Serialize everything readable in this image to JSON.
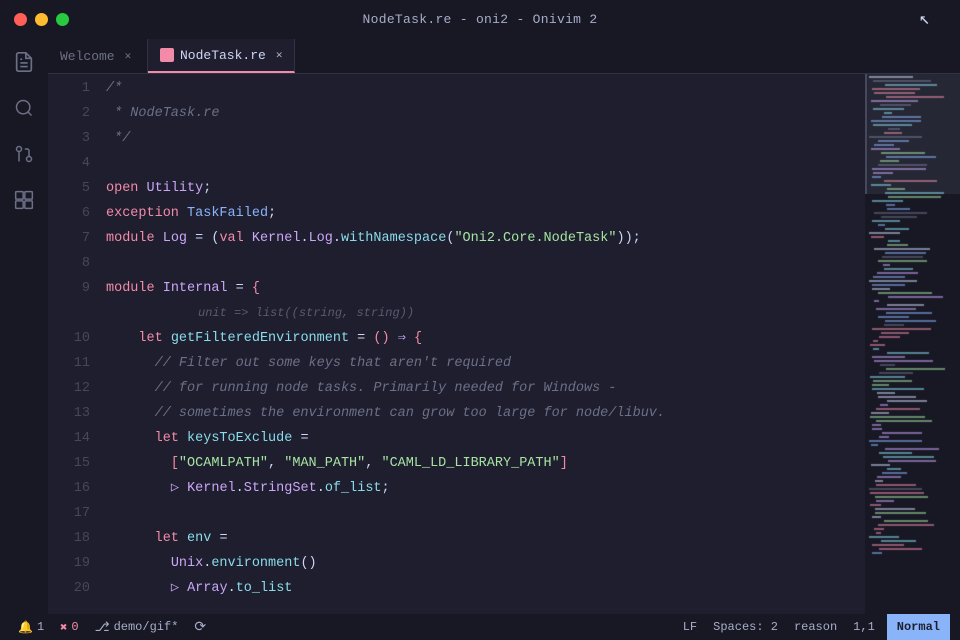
{
  "titlebar": {
    "title": "NodeTask.re - oni2 - Onivim 2"
  },
  "tabs": [
    {
      "id": "welcome",
      "label": "Welcome",
      "active": false,
      "has_icon": false
    },
    {
      "id": "nodetask",
      "label": "NodeTask.re",
      "active": true,
      "has_icon": true
    }
  ],
  "code": {
    "lines": [
      {
        "num": 1,
        "tokens": [
          {
            "t": "kw-comment",
            "v": "/*"
          }
        ]
      },
      {
        "num": 2,
        "tokens": [
          {
            "t": "kw-comment",
            "v": " * NodeTask.re"
          }
        ]
      },
      {
        "num": 3,
        "tokens": [
          {
            "t": "kw-comment",
            "v": " */"
          }
        ]
      },
      {
        "num": 4,
        "tokens": []
      },
      {
        "num": 5,
        "tokens": [
          {
            "t": "kw-keyword",
            "v": "open"
          },
          {
            "t": "kw-normal",
            "v": " "
          },
          {
            "t": "kw-module",
            "v": "Utility"
          },
          {
            "t": "kw-normal",
            "v": ";"
          }
        ]
      },
      {
        "num": 6,
        "tokens": [
          {
            "t": "kw-keyword",
            "v": "exception"
          },
          {
            "t": "kw-normal",
            "v": " "
          },
          {
            "t": "kw-type",
            "v": "TaskFailed"
          },
          {
            "t": "kw-normal",
            "v": ";"
          }
        ]
      },
      {
        "num": 7,
        "tokens": [
          {
            "t": "kw-keyword",
            "v": "module"
          },
          {
            "t": "kw-normal",
            "v": " "
          },
          {
            "t": "kw-module",
            "v": "Log"
          },
          {
            "t": "kw-normal",
            "v": " = ("
          },
          {
            "t": "kw-keyword",
            "v": "val"
          },
          {
            "t": "kw-normal",
            "v": " "
          },
          {
            "t": "kw-module",
            "v": "Kernel"
          },
          {
            "t": "kw-normal",
            "v": "."
          },
          {
            "t": "kw-module",
            "v": "Log"
          },
          {
            "t": "kw-normal",
            "v": "."
          },
          {
            "t": "kw-method",
            "v": "withNamespace"
          },
          {
            "t": "kw-normal",
            "v": "("
          },
          {
            "t": "kw-string",
            "v": "\"Oni2.Core.NodeTask\""
          },
          {
            "t": "kw-normal",
            "v": "));"
          }
        ]
      },
      {
        "num": 8,
        "tokens": []
      },
      {
        "num": 9,
        "tokens": [
          {
            "t": "kw-keyword",
            "v": "module"
          },
          {
            "t": "kw-normal",
            "v": " "
          },
          {
            "t": "kw-module",
            "v": "Internal"
          },
          {
            "t": "kw-normal",
            "v": " = "
          },
          {
            "t": "kw-bracket",
            "v": "{"
          }
        ]
      },
      {
        "num": "hint",
        "tokens": [
          {
            "t": "hint-line",
            "v": "    unit => list((string, string))"
          }
        ]
      },
      {
        "num": 10,
        "tokens": [
          {
            "t": "kw-normal",
            "v": "    "
          },
          {
            "t": "kw-keyword",
            "v": "let"
          },
          {
            "t": "kw-normal",
            "v": " "
          },
          {
            "t": "kw-varname",
            "v": "getFilteredEnvironment"
          },
          {
            "t": "kw-normal",
            "v": " = "
          },
          {
            "t": "kw-bracket",
            "v": "()"
          },
          {
            "t": "kw-normal",
            "v": " "
          },
          {
            "t": "kw-arrow",
            "v": "=>"
          },
          {
            "t": "kw-normal",
            "v": " "
          },
          {
            "t": "kw-bracket",
            "v": "{"
          }
        ]
      },
      {
        "num": 11,
        "tokens": [
          {
            "t": "kw-normal",
            "v": "      "
          },
          {
            "t": "kw-italic-comment",
            "v": "// Filter out some keys that aren't required"
          }
        ]
      },
      {
        "num": 12,
        "tokens": [
          {
            "t": "kw-normal",
            "v": "      "
          },
          {
            "t": "kw-italic-comment",
            "v": "// for running node tasks. Primarily needed for Windows -"
          }
        ]
      },
      {
        "num": 13,
        "tokens": [
          {
            "t": "kw-normal",
            "v": "      "
          },
          {
            "t": "kw-italic-comment",
            "v": "// sometimes the environment can grow too large for node/libuv."
          }
        ]
      },
      {
        "num": 14,
        "tokens": [
          {
            "t": "kw-normal",
            "v": "      "
          },
          {
            "t": "kw-keyword",
            "v": "let"
          },
          {
            "t": "kw-normal",
            "v": " "
          },
          {
            "t": "kw-varname",
            "v": "keysToExclude"
          },
          {
            "t": "kw-normal",
            "v": " ="
          }
        ]
      },
      {
        "num": 15,
        "tokens": [
          {
            "t": "kw-normal",
            "v": "        "
          },
          {
            "t": "kw-bracket",
            "v": "["
          },
          {
            "t": "kw-string",
            "v": "\"OCAMLPATH\""
          },
          {
            "t": "kw-normal",
            "v": ", "
          },
          {
            "t": "kw-string",
            "v": "\"MAN_PATH\""
          },
          {
            "t": "kw-normal",
            "v": ", "
          },
          {
            "t": "kw-string",
            "v": "\"CAML_LD_LIBRARY_PATH\""
          },
          {
            "t": "kw-bracket",
            "v": "]"
          }
        ]
      },
      {
        "num": 16,
        "tokens": [
          {
            "t": "kw-normal",
            "v": "        "
          },
          {
            "t": "kw-triangle",
            "v": "▷"
          },
          {
            "t": "kw-normal",
            "v": " "
          },
          {
            "t": "kw-module",
            "v": "Kernel"
          },
          {
            "t": "kw-normal",
            "v": "."
          },
          {
            "t": "kw-module",
            "v": "StringSet"
          },
          {
            "t": "kw-normal",
            "v": "."
          },
          {
            "t": "kw-method",
            "v": "of_list"
          },
          {
            "t": "kw-normal",
            "v": ";"
          }
        ]
      },
      {
        "num": 17,
        "tokens": []
      },
      {
        "num": 18,
        "tokens": [
          {
            "t": "kw-normal",
            "v": "      "
          },
          {
            "t": "kw-keyword",
            "v": "let"
          },
          {
            "t": "kw-normal",
            "v": " "
          },
          {
            "t": "kw-varname",
            "v": "env"
          },
          {
            "t": "kw-normal",
            "v": " ="
          }
        ]
      },
      {
        "num": 19,
        "tokens": [
          {
            "t": "kw-normal",
            "v": "        "
          },
          {
            "t": "kw-module",
            "v": "Unix"
          },
          {
            "t": "kw-normal",
            "v": "."
          },
          {
            "t": "kw-method",
            "v": "environment"
          },
          {
            "t": "kw-normal",
            "v": "()"
          }
        ]
      },
      {
        "num": 20,
        "tokens": [
          {
            "t": "kw-normal",
            "v": "        "
          },
          {
            "t": "kw-triangle",
            "v": "▷"
          },
          {
            "t": "kw-normal",
            "v": " "
          },
          {
            "t": "kw-module",
            "v": "Array"
          },
          {
            "t": "kw-normal",
            "v": "."
          },
          {
            "t": "kw-method",
            "v": "to_list"
          }
        ]
      }
    ]
  },
  "status_bar": {
    "bell": "🔔",
    "bell_count": "1",
    "error_icon": "✖",
    "error_count": "0",
    "branch_icon": "⎇",
    "branch_name": "demo/gif*",
    "sync_icon": "⟳",
    "lf_label": "LF",
    "spaces_label": "Spaces: 2",
    "reason_label": "reason",
    "position_label": "1,1",
    "mode_label": "Normal"
  }
}
